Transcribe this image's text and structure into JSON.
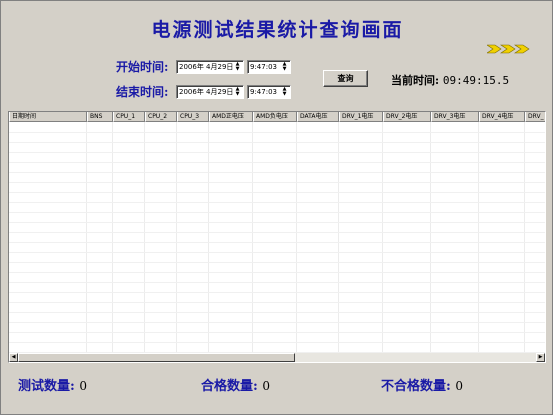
{
  "title": "电源测试结果统计查询画面",
  "start_label": "开始时间:",
  "end_label": "结束时间:",
  "start": {
    "date": "2006年 4月29日",
    "time": "9:47:03"
  },
  "end": {
    "date": "2006年 4月29日",
    "time": "9:47:03"
  },
  "query_button": "查询",
  "current_time_label": "当前时间:",
  "current_time": "09:49:15.5",
  "table": {
    "columns": [
      "日期时间",
      "BNS",
      "CPU_1",
      "CPU_2",
      "CPU_3",
      "AMD正电压",
      "AMD负电压",
      "DATA电压",
      "DRV_1电压",
      "DRV_2电压",
      "DRV_3电压",
      "DRV_4电压",
      "DRV_"
    ]
  },
  "stats": {
    "test_label": "测试数量:",
    "test_count": "0",
    "pass_label": "合格数量:",
    "pass_count": "0",
    "fail_label": "不合格数量:",
    "fail_count": "0"
  },
  "colors": {
    "accent": "#1a1aa6",
    "arrows": "#e8c400",
    "background": "#d4d0c8"
  }
}
